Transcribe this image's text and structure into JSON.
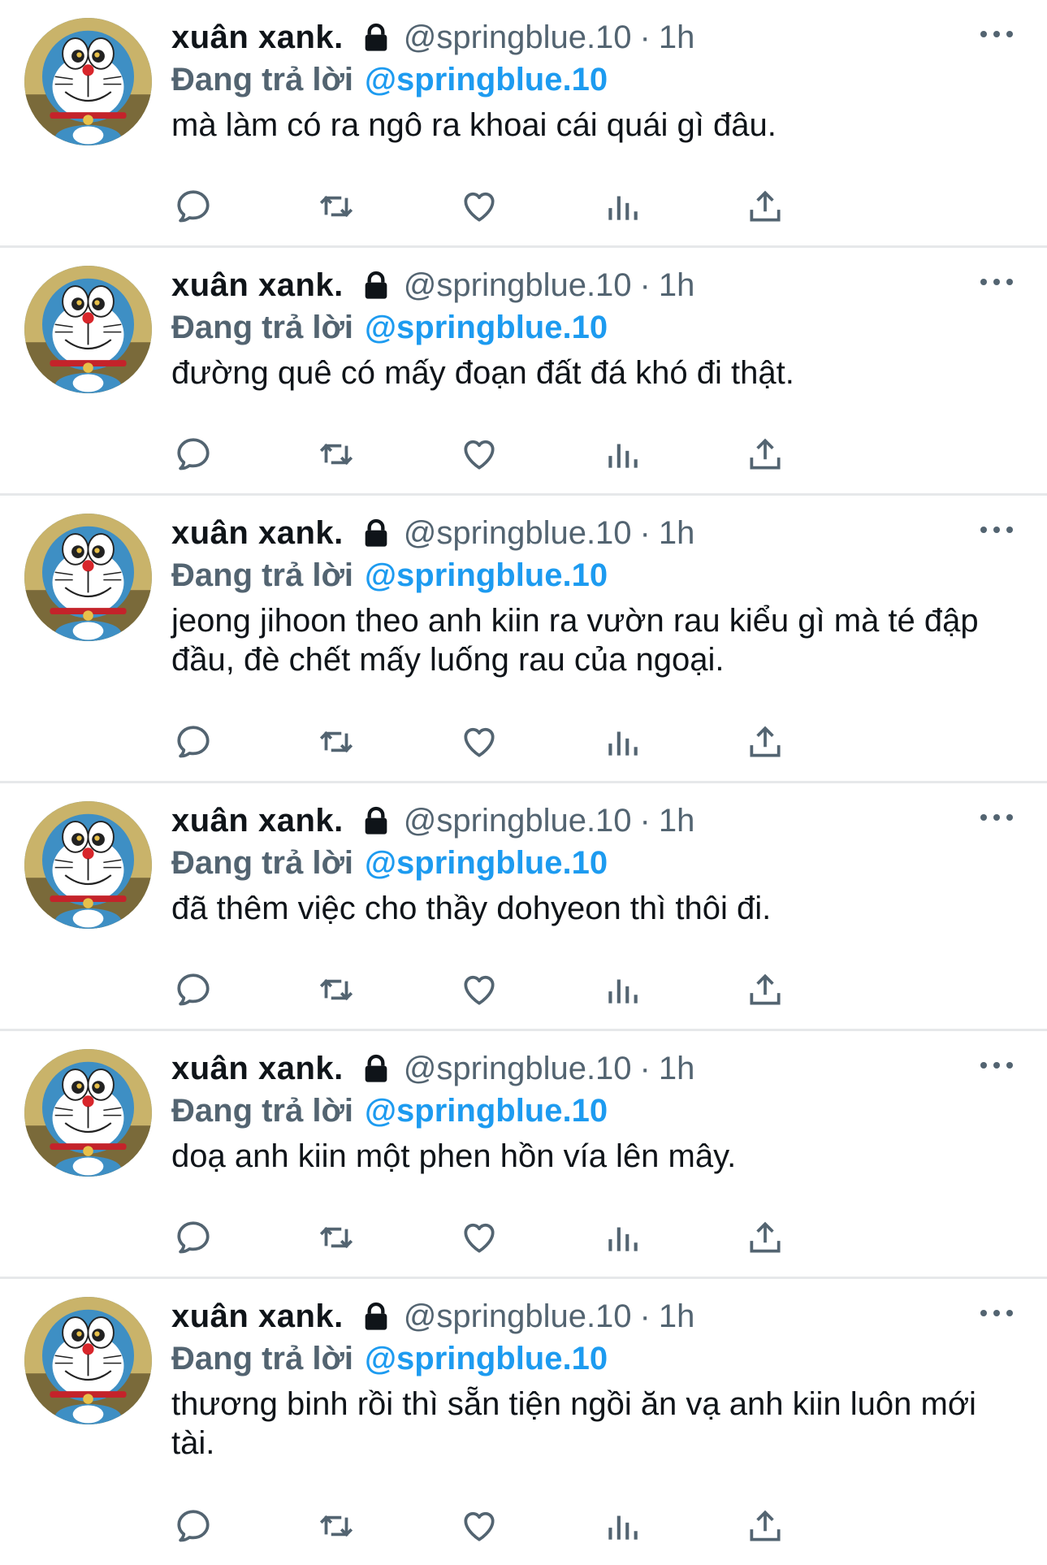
{
  "colors": {
    "accent": "#1d9bf0",
    "secondary_text": "#536471",
    "primary_text": "#0f1419",
    "divider": "#e6e8ea"
  },
  "icons": {
    "avatar": "doraemon-avatar",
    "lock": "lock-icon",
    "more": "more-options-icon",
    "actions": [
      "reply-icon",
      "retweet-icon",
      "like-icon",
      "views-icon",
      "share-icon"
    ]
  },
  "tweets": [
    {
      "name": "xuân xank.",
      "handle": "@springblue.10",
      "dot": "·",
      "time": "1h",
      "reply_label": "Đang trả lời",
      "reply_handle": "@springblue.10",
      "text": "mà làm có ra ngô ra khoai cái quái gì đâu."
    },
    {
      "name": "xuân xank.",
      "handle": "@springblue.10",
      "dot": "·",
      "time": "1h",
      "reply_label": "Đang trả lời",
      "reply_handle": "@springblue.10",
      "text": "đường quê có mấy đoạn đất đá khó đi thật."
    },
    {
      "name": "xuân xank.",
      "handle": "@springblue.10",
      "dot": "·",
      "time": "1h",
      "reply_label": "Đang trả lời",
      "reply_handle": "@springblue.10",
      "text": "jeong jihoon theo anh kiin ra vườn rau kiểu gì mà té đập đầu, đè chết mấy luống rau của ngoại."
    },
    {
      "name": "xuân xank.",
      "handle": "@springblue.10",
      "dot": "·",
      "time": "1h",
      "reply_label": "Đang trả lời",
      "reply_handle": "@springblue.10",
      "text": "đã thêm việc cho thầy dohyeon thì thôi đi."
    },
    {
      "name": "xuân xank.",
      "handle": "@springblue.10",
      "dot": "·",
      "time": "1h",
      "reply_label": "Đang trả lời",
      "reply_handle": "@springblue.10",
      "text": "doạ anh kiin một phen hồn vía lên mây."
    },
    {
      "name": "xuân xank.",
      "handle": "@springblue.10",
      "dot": "·",
      "time": "1h",
      "reply_label": "Đang trả lời",
      "reply_handle": "@springblue.10",
      "text": "thương binh rồi thì sẵn tiện ngồi ăn vạ anh kiin luôn mới tài."
    }
  ]
}
